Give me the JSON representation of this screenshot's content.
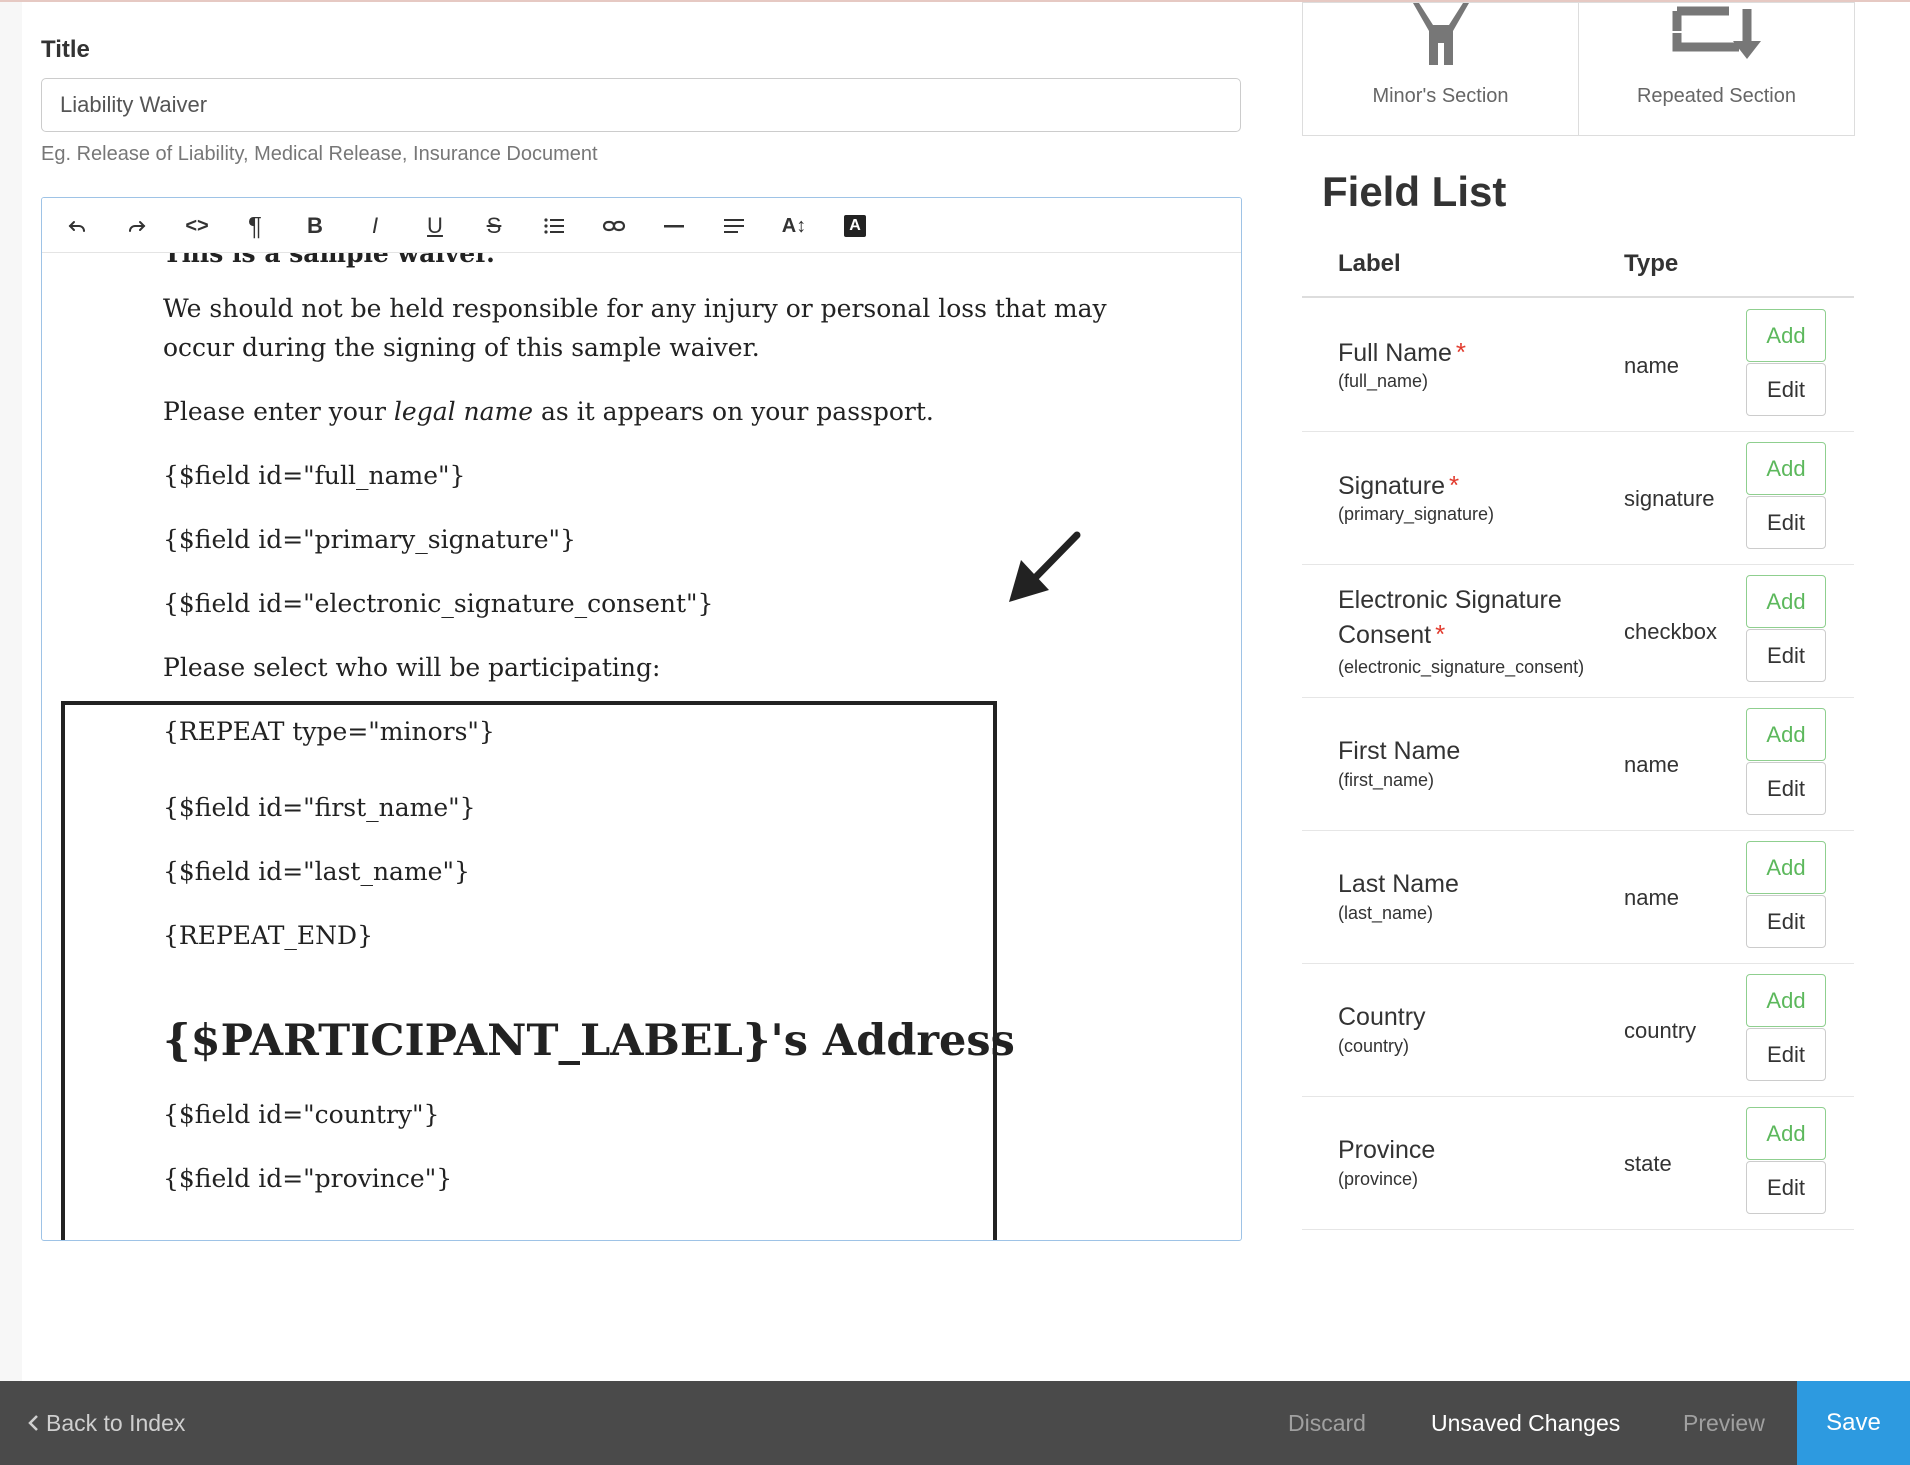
{
  "form": {
    "title_label": "Title",
    "title_value": "Liability Waiver",
    "title_help": "Eg. Release of Liability, Medical Release, Insurance Document"
  },
  "toolbar": {
    "buttons": [
      "undo-icon",
      "redo-icon",
      "code-icon",
      "paragraph-icon",
      "bold-icon",
      "italic-icon",
      "underline-icon",
      "strikethrough-icon",
      "list-icon",
      "link-icon",
      "horizontal-rule-icon",
      "align-icon",
      "font-size-icon",
      "text-color-icon"
    ],
    "bold_glyph": "B",
    "italic_glyph": "I",
    "underline_glyph": "U",
    "strike_glyph": "S",
    "paragraph_glyph": "¶",
    "code_glyph": "<>",
    "fontsize_glyph": "A↕",
    "textcolor_glyph": "A"
  },
  "document": {
    "cutoff_line": "This is a sample waiver.",
    "intro_1": "We should not be held responsible for any injury or personal loss that may",
    "intro_2": "occur during the signing of this sample waiver.",
    "legal_prefix": "Please enter your ",
    "legal_em": "legal name",
    "legal_suffix": " as it appears on your passport.",
    "field_full_name": "{$field id=\"full_name\"}",
    "field_primary_signature": "{$field id=\"primary_signature\"}",
    "field_consent": "{$field id=\"electronic_signature_consent\"}",
    "select_participants": "Please select who will be participating:",
    "repeat_start": "{REPEAT type=\"minors\"}",
    "field_first_name": "{$field id=\"first_name\"}",
    "field_last_name": "{$field id=\"last_name\"}",
    "repeat_end": "{REPEAT_END}",
    "address_heading": "{$PARTICIPANT_LABEL}'s Address",
    "field_country": "{$field id=\"country\"}",
    "field_province": "{$field id=\"province\"}"
  },
  "sections": {
    "minor_label": "Minor's Section",
    "minor_icon": "person-icon",
    "repeated_label": "Repeated Section",
    "repeated_icon": "repeat-icon"
  },
  "field_list": {
    "title": "Field List",
    "col_label": "Label",
    "col_type": "Type",
    "add_label": "Add",
    "edit_label": "Edit",
    "required_mark": "*",
    "rows": [
      {
        "label": "Full Name",
        "id": "(full_name)",
        "type": "name",
        "required": true
      },
      {
        "label": "Signature",
        "id": "(primary_signature)",
        "type": "signature",
        "required": true
      },
      {
        "label_line1": "Electronic Signature",
        "label_line2": "Consent",
        "id": "(electronic_signature_consent)",
        "type": "checkbox",
        "required": true
      },
      {
        "label": "First Name",
        "id": "(first_name)",
        "type": "name",
        "required": false
      },
      {
        "label": "Last Name",
        "id": "(last_name)",
        "type": "name",
        "required": false
      },
      {
        "label": "Country",
        "id": "(country)",
        "type": "country",
        "required": false
      },
      {
        "label": "Province",
        "id": "(province)",
        "type": "state",
        "required": false
      }
    ]
  },
  "footer": {
    "back_label": "Back to Index",
    "discard_label": "Discard",
    "unsaved_label": "Unsaved Changes",
    "preview_label": "Preview",
    "save_label": "Save"
  },
  "colors": {
    "accent": "#2d9ae0",
    "add_green": "#5cb85c",
    "required_red": "#e23b2e",
    "footer_bg": "#4a4a4a"
  }
}
